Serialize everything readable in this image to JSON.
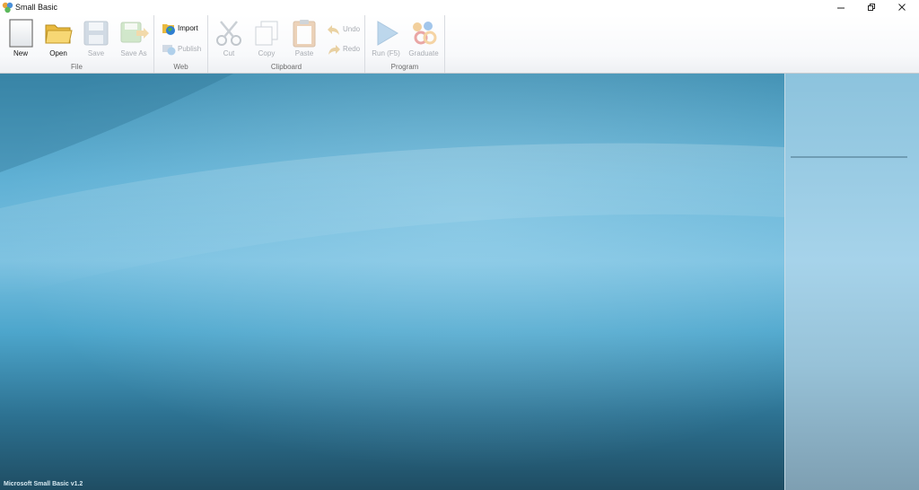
{
  "window": {
    "title": "Small Basic",
    "minimize_glyph": "—",
    "restore_glyph": "❐",
    "close_glyph": "✕"
  },
  "ribbon": {
    "groups": {
      "file": "File",
      "web": "Web",
      "clipboard": "Clipboard",
      "program": "Program"
    },
    "buttons": {
      "new": "New",
      "open": "Open",
      "save": "Save",
      "save_as": "Save As",
      "import": "Import",
      "publish": "Publish",
      "cut": "Cut",
      "copy": "Copy",
      "paste": "Paste",
      "undo": "Undo",
      "redo": "Redo",
      "run": "Run (F5)",
      "graduate": "Graduate"
    }
  },
  "status": {
    "version": "Microsoft Small Basic v1.2"
  },
  "colors": {
    "canvas_top": "#3f8fb2",
    "canvas_bottom": "#1f4d63",
    "side_panel": "#a6d3ea",
    "disabled_text": "#a9adb3"
  },
  "icons": {
    "new": "blank-document-icon",
    "open": "folder-icon",
    "save": "floppy-disk-icon",
    "save_as": "floppy-arrow-icon",
    "import": "globe-folder-icon",
    "publish": "globe-monitor-icon",
    "cut": "scissors-icon",
    "copy": "copy-icon",
    "paste": "clipboard-icon",
    "undo": "undo-arrow-icon",
    "redo": "redo-arrow-icon",
    "run": "play-triangle-icon",
    "graduate": "graduate-icon"
  }
}
